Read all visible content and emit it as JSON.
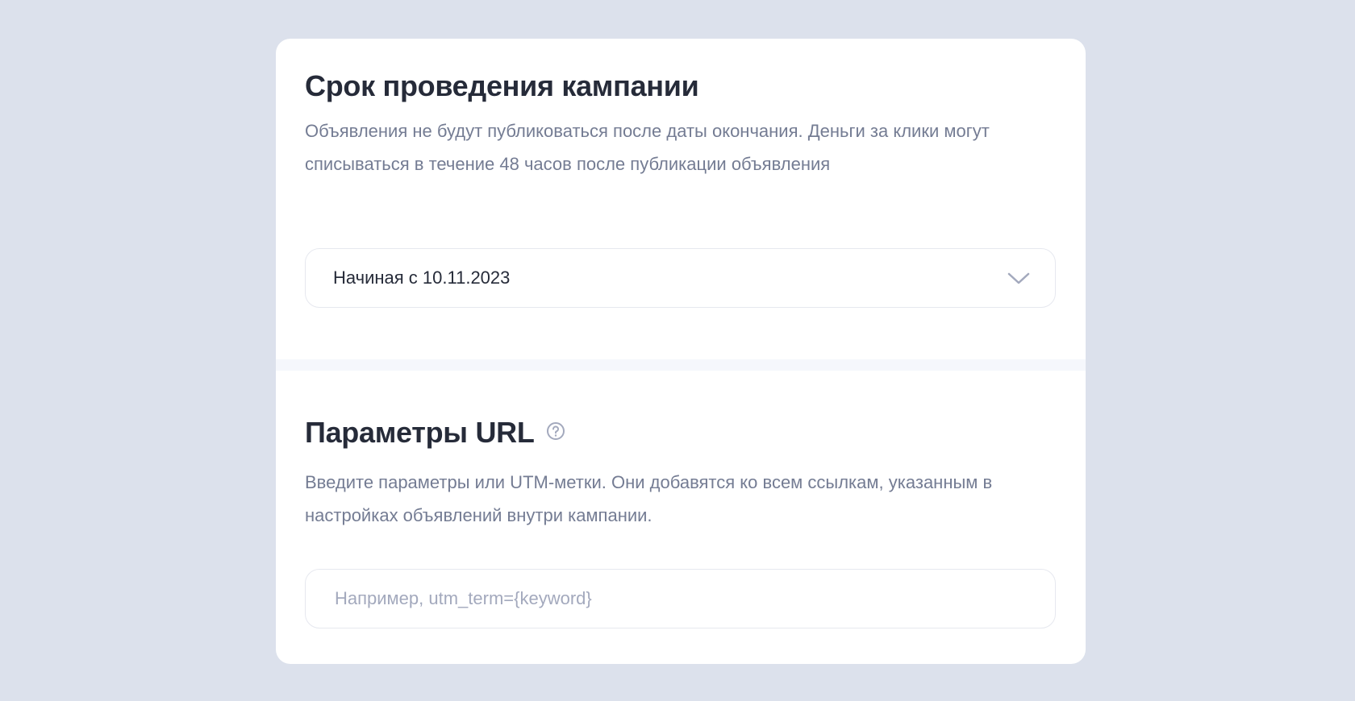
{
  "campaign_period": {
    "title": "Срок проведения кампании",
    "description": "Объявления не будут публиковаться после даты окончания. Деньги за клики могут списываться в течение 48 часов после публикации объявления",
    "select_value": "Начиная с 10.11.2023"
  },
  "url_params": {
    "title": "Параметры URL",
    "description": "Введите параметры или UTM-метки. Они добавятся ко всем ссылкам, указанным в настройках объявлений внутри кампании.",
    "input_value": "",
    "input_placeholder": "Например, utm_term={keyword}"
  }
}
